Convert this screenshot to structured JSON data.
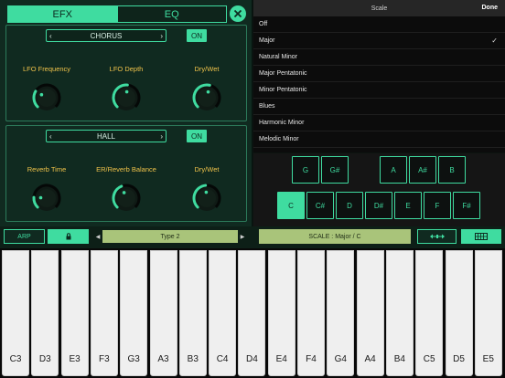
{
  "efx": {
    "tabs": [
      "EFX",
      "EQ"
    ],
    "chorus": {
      "name": "CHORUS",
      "state": "ON",
      "knobs": [
        "LFO Frequency",
        "LFO Depth",
        "Dry/Wet"
      ],
      "levels": [
        0.28,
        0.52,
        0.55
      ]
    },
    "hall": {
      "name": "HALL",
      "state": "ON",
      "knobs": [
        "Reverb Time",
        "ER/Reverb Balance",
        "Dry/Wet"
      ],
      "levels": [
        0.18,
        0.42,
        0.48
      ]
    }
  },
  "scale": {
    "title": "Scale",
    "done": "Done",
    "options": [
      "Off",
      "Major",
      "Natural Minor",
      "Major Pentatonic",
      "Minor Pentatonic",
      "Blues",
      "Harmonic Minor",
      "Melodic Minor"
    ],
    "selected": "Major"
  },
  "notes": {
    "top": [
      "G",
      "G#",
      "A",
      "A#",
      "B"
    ],
    "bottom": [
      "C",
      "C#",
      "D",
      "D#",
      "E",
      "F",
      "F#"
    ],
    "selected": "C"
  },
  "toolbar": {
    "arp": "ARP",
    "type": "Type 2",
    "scale_display": "SCALE : Major / C",
    "lock_icon": "lock-icon",
    "arrows_icon": "arrows-icon",
    "grid_icon": "keyboard-grid-icon"
  },
  "keyboard": {
    "keys": [
      "C3",
      "D3",
      "E3",
      "F3",
      "G3",
      "A3",
      "B3",
      "C4",
      "D4",
      "E4",
      "F4",
      "G4",
      "A4",
      "B4",
      "C5",
      "D5",
      "E5"
    ]
  },
  "colors": {
    "accent": "#3fdca0",
    "label": "#f0c34a",
    "panel": "#102a20",
    "lcd": "#a9c47a"
  }
}
